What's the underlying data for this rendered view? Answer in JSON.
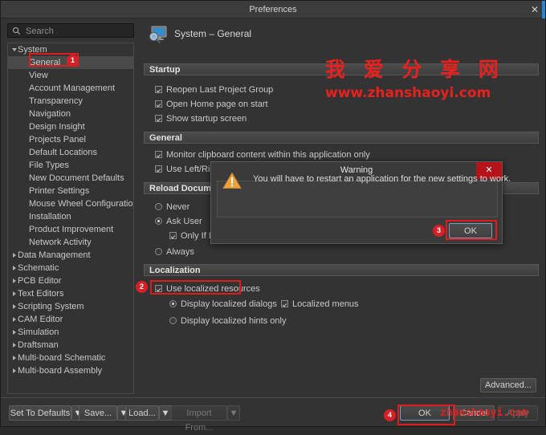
{
  "window": {
    "title": "Preferences",
    "close_icon": "✕"
  },
  "search": {
    "placeholder": "Search",
    "value": "",
    "icon": "search-icon"
  },
  "sidebar": {
    "root": {
      "label": "System",
      "expanded": true
    },
    "children": [
      "General",
      "View",
      "Account Management",
      "Transparency",
      "Navigation",
      "Design Insight",
      "Projects Panel",
      "Default Locations",
      "File Types",
      "New Document Defaults",
      "Printer Settings",
      "Mouse Wheel Configuration",
      "Installation",
      "Product Improvement",
      "Network Activity"
    ],
    "selected": "General",
    "groups": [
      "Data Management",
      "Schematic",
      "PCB Editor",
      "Text Editors",
      "Scripting System",
      "CAM Editor",
      "Simulation",
      "Draftsman",
      "Multi-board Schematic",
      "Multi-board Assembly"
    ]
  },
  "page": {
    "icon": "system-monitor-search-icon",
    "title": "System – General",
    "sections": {
      "startup": {
        "header": "Startup",
        "options": [
          {
            "label": "Reopen Last Project Group",
            "checked": true
          },
          {
            "label": "Open Home page on start",
            "checked": true
          },
          {
            "label": "Show startup screen",
            "checked": true
          }
        ]
      },
      "general": {
        "header": "General",
        "options": [
          {
            "label": "Monitor clipboard content within this application only",
            "checked": true
          },
          {
            "label": "Use Left/Right",
            "checked": true
          }
        ]
      },
      "reload_document": {
        "header": "Reload Document",
        "options": [
          {
            "label": "Never",
            "selected": false
          },
          {
            "label": "Ask User",
            "selected": true
          },
          {
            "label": "Only If Doc",
            "checked": true,
            "sub": true
          },
          {
            "label": "Always",
            "selected": false
          }
        ]
      },
      "localization": {
        "header": "Localization",
        "use_localized_resources": {
          "label": "Use localized resources",
          "checked": true
        },
        "display_localized_dialogs": {
          "label": "Display localized dialogs",
          "selected": true
        },
        "display_localized_hints_only": {
          "label": "Display localized hints only",
          "selected": false
        },
        "localized_menus": {
          "label": "Localized menus",
          "checked": true
        }
      }
    },
    "advanced_button": "Advanced..."
  },
  "footer": {
    "set_to_defaults": "Set To Defaults",
    "save": "Save...",
    "load": "Load...",
    "import_from": "Import From...",
    "import_from_disabled": true,
    "ok": "OK",
    "cancel": "Cancel",
    "apply": "Apply",
    "dropdown_icon": "▼"
  },
  "dialog": {
    "title": "Warning",
    "close_icon": "✕",
    "icon": "warning-triangle-icon",
    "message": "You will have to restart an application for the new settings to work.",
    "ok": "OK"
  },
  "annotations": {
    "badges": [
      "1",
      "2",
      "3",
      "4"
    ],
    "highlight_color": "#e01b1b",
    "badge_color": "#d81f26"
  },
  "watermark": {
    "line1": "我 爱 分 享 网",
    "line2": "www.zhanshaoyi.com",
    "line3": "zhanshaoyi.com",
    "color": "#e8211f"
  }
}
